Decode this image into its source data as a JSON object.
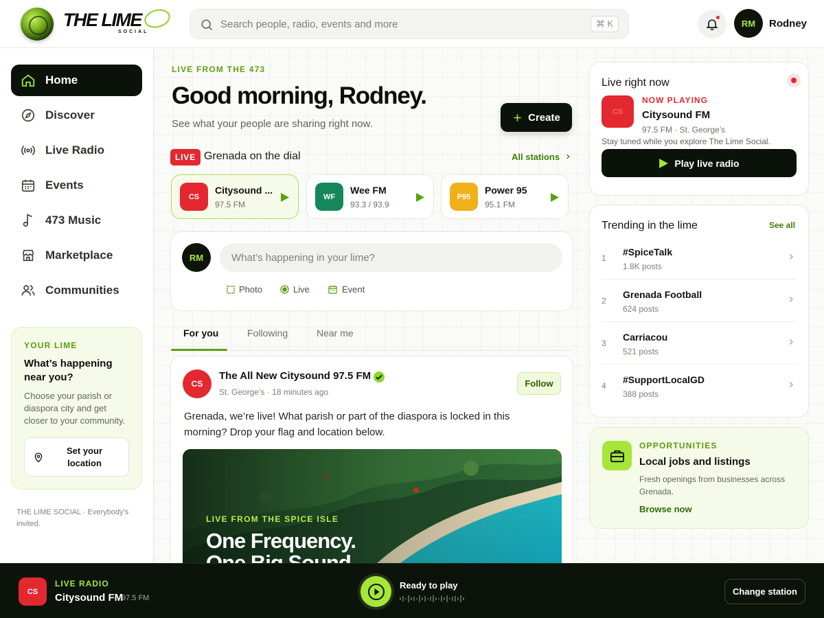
{
  "brand": {
    "name": "THE LIME",
    "sub": "SOCIAL"
  },
  "search": {
    "placeholder": "Search people, radio, events and more",
    "shortcut": "⌘ K"
  },
  "user": {
    "initials": "RM",
    "name": "Rodney"
  },
  "sidebar": {
    "items": [
      {
        "label": "Home",
        "icon": "home-icon",
        "active": true
      },
      {
        "label": "Discover",
        "icon": "compass-icon"
      },
      {
        "label": "Live Radio",
        "icon": "radio-icon"
      },
      {
        "label": "Events",
        "icon": "calendar-icon"
      },
      {
        "label": "473 Music",
        "icon": "music-note-icon"
      },
      {
        "label": "Marketplace",
        "icon": "store-icon"
      },
      {
        "label": "Communities",
        "icon": "users-icon"
      }
    ],
    "your_lime": {
      "eyebrow": "YOUR LIME",
      "title": "What’s happening near you?",
      "description": "Choose your parish or diaspora city and get closer to your community.",
      "button": "Set your location"
    },
    "footer": "THE LIME SOCIAL · Everybody’s invited."
  },
  "main": {
    "eyebrow": "LIVE FROM THE 473",
    "greeting": "Good morning, Rodney.",
    "subtitle": "See what your people are sharing right now.",
    "create_label": "Create",
    "live_badge": "LIVE",
    "dial_title": "Grenada on the dial",
    "all_stations": "All stations",
    "stations": [
      {
        "abbr": "CS",
        "name": "Citysound ...",
        "freq": "97.5 FM",
        "color": "#e3282f"
      },
      {
        "abbr": "WF",
        "name": "Wee FM",
        "freq": "93.3 / 93.9",
        "color": "#14885a"
      },
      {
        "abbr": "P95",
        "name": "Power 95",
        "freq": "95.1 FM",
        "color": "#f0b01a"
      }
    ],
    "composer": {
      "initials": "RM",
      "placeholder": "What’s happening in your lime?",
      "actions": {
        "photo": "Photo",
        "live": "Live",
        "event": "Event"
      }
    },
    "tabs": [
      "For you",
      "Following",
      "Near me"
    ],
    "post": {
      "initials": "CS",
      "author": "The All New Citysound 97.5 FM",
      "meta": "St. George’s · 18 minutes ago",
      "follow": "Follow",
      "text": "Grenada, we’re live! What parish or part of the diaspora is locked in this morning? Drop your flag and location below.",
      "image_eyebrow": "LIVE FROM THE SPICE ISLE",
      "image_headline_1": "One Frequency.",
      "image_headline_2": "One Big Sound."
    }
  },
  "right": {
    "live_now": {
      "title": "Live right now",
      "abbr": "CS",
      "label": "NOW PLAYING",
      "station": "Citysound FM",
      "meta": "97.5 FM · St. George’s",
      "note": "Stay tuned while you explore The Lime Social.",
      "button": "Play live radio"
    },
    "trending": {
      "title": "Trending in the lime",
      "see_all": "See all",
      "items": [
        {
          "rank": "1",
          "tag": "#SpiceTalk",
          "count": "1.8K posts"
        },
        {
          "rank": "2",
          "tag": "Grenada Football",
          "count": "624 posts"
        },
        {
          "rank": "3",
          "tag": "Carriacou",
          "count": "521 posts"
        },
        {
          "rank": "4",
          "tag": "#SupportLocalGD",
          "count": "388 posts"
        }
      ]
    },
    "opportunities": {
      "eyebrow": "OPPORTUNITIES",
      "title": "Local jobs and listings",
      "description": "Fresh openings from businesses across Grenada.",
      "link": "Browse now"
    }
  },
  "player": {
    "abbr": "CS",
    "eyebrow": "LIVE RADIO",
    "station": "Citysound FM",
    "freq": "97.5 FM",
    "status": "Ready to play",
    "change": "Change station"
  },
  "colors": {
    "accent": "#a6e53a",
    "accent_dark": "#5a9a0f",
    "live_red": "#e3282f",
    "ink": "#0b120a"
  }
}
